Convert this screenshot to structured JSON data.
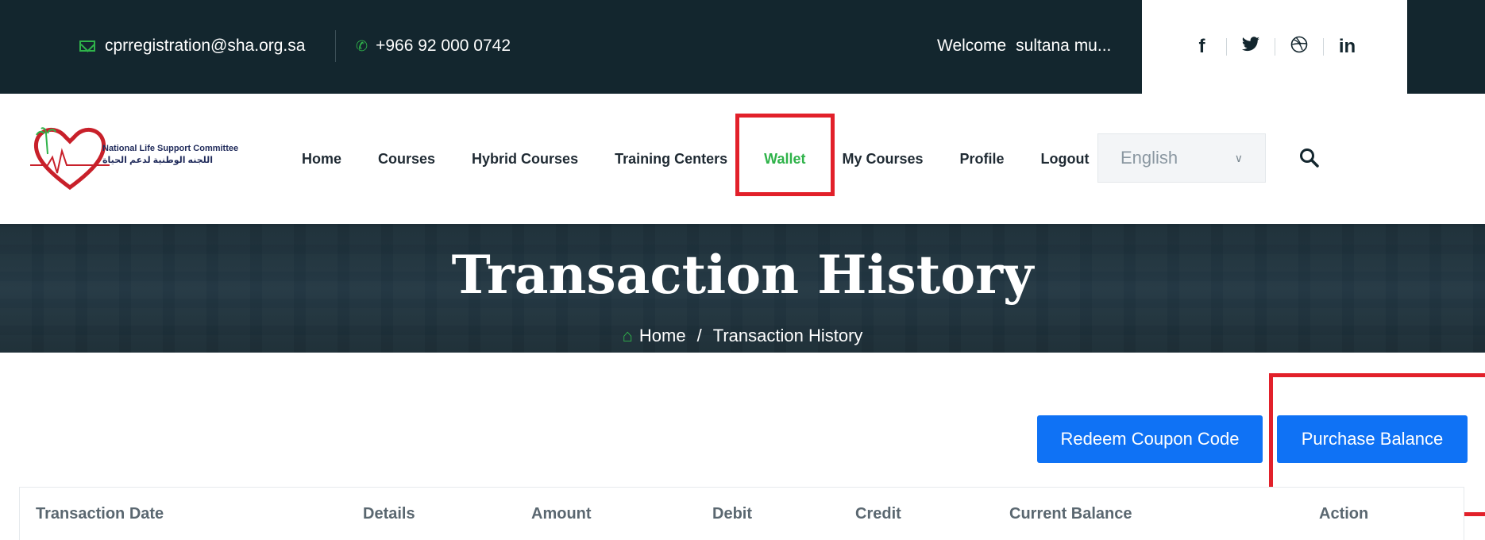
{
  "topbar": {
    "email": "cprregistration@sha.org.sa",
    "phone": "+966 92 000 0742",
    "welcome_label": "Welcome",
    "user_name": "sultana mu...",
    "social": [
      "f",
      "🐦",
      "⊛",
      "in"
    ]
  },
  "nav": {
    "logo_en": "National Life Support Committee",
    "logo_ar": "اللجنه الوطنية لدعم الحياة",
    "items": [
      {
        "label": "Home"
      },
      {
        "label": "Courses"
      },
      {
        "label": "Hybrid Courses"
      },
      {
        "label": "Training Centers"
      },
      {
        "label": "Wallet"
      },
      {
        "label": "My Courses"
      },
      {
        "label": "Profile"
      },
      {
        "label": "Logout"
      }
    ],
    "language": "English"
  },
  "hero": {
    "title": "Transaction History",
    "crumb_home": "Home",
    "crumb_sep": "/",
    "crumb_current": "Transaction History"
  },
  "actions": {
    "redeem": "Redeem Coupon Code",
    "purchase": "Purchase Balance"
  },
  "table": {
    "columns": [
      "Transaction Date",
      "Details",
      "Amount",
      "Debit",
      "Credit",
      "Current Balance",
      "Action"
    ]
  },
  "colors": {
    "topbar": "#13262e",
    "accent_green": "#2fb34a",
    "button_blue": "#0f72f5",
    "highlight_red": "#e2202a"
  }
}
